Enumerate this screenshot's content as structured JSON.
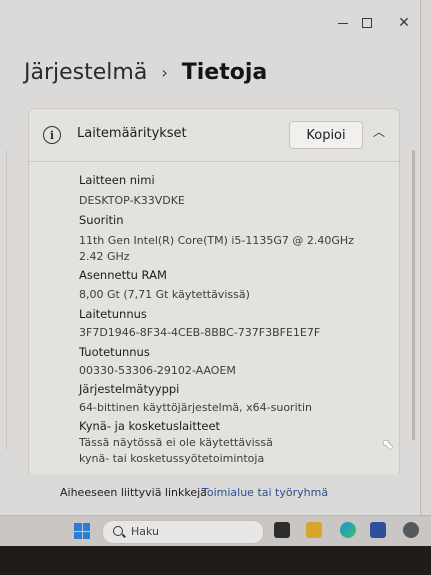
{
  "window": {
    "controls": {
      "minimize": "minimize-icon",
      "maximize": "maximize-icon",
      "close": "close-icon"
    }
  },
  "breadcrumb": {
    "parent": "Järjestelmä",
    "separator": "›",
    "current": "Tietoja"
  },
  "device_specs": {
    "title": "Laitemääritykset",
    "copy_label": "Kopioi",
    "items": [
      {
        "label": "Laitteen nimi",
        "value": "DESKTOP-K33VDKE"
      },
      {
        "label": "Suoritin",
        "value": "11th Gen Intel(R) Core(TM) i5-1135G7 @ 2.40GHz   2.42 GHz"
      },
      {
        "label": "Asennettu RAM",
        "value": "8,00 Gt (7,71 Gt käytettävissä)"
      },
      {
        "label": "Laitetunnus",
        "value": "3F7D1946-8F34-4CEB-8BBC-737F3BFE1E7F"
      },
      {
        "label": "Tuotetunnus",
        "value": "00330-53306-29102-AAOEM"
      },
      {
        "label": "Järjestelmätyyppi",
        "value": "64-bittinen käyttöjärjestelmä, x64-suoritin"
      },
      {
        "label": "Kynä- ja kosketuslaitteet",
        "value": "Tässä näytössä ei ole käytettävissä kynä- tai kosketussyötetoimintoja"
      }
    ]
  },
  "related": {
    "label": "Aiheeseen liittyviä linkkejä",
    "link": "Toimialue tai työryhmä"
  },
  "taskbar": {
    "search_placeholder": "Haku"
  }
}
